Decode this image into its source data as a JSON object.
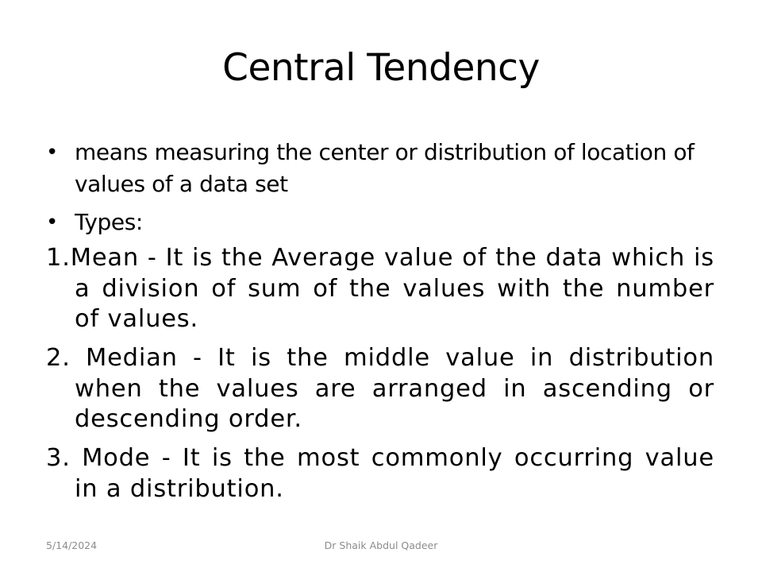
{
  "slide": {
    "title": "Central Tendency",
    "bullets": [
      "means measuring the center or distribution of location of values of a data set",
      "Types:"
    ],
    "numbered_items": [
      "1.Mean - It is the Average value of the data which is a division of sum of the values with the number of values.",
      "2. Median - It is the middle value in distribution when the values are arranged in ascending or descending order.",
      "3. Mode - It is the most commonly occurring value in a distribution."
    ],
    "footer": {
      "date": "5/14/2024",
      "author": "Dr Shaik Abdul Qadeer"
    }
  }
}
